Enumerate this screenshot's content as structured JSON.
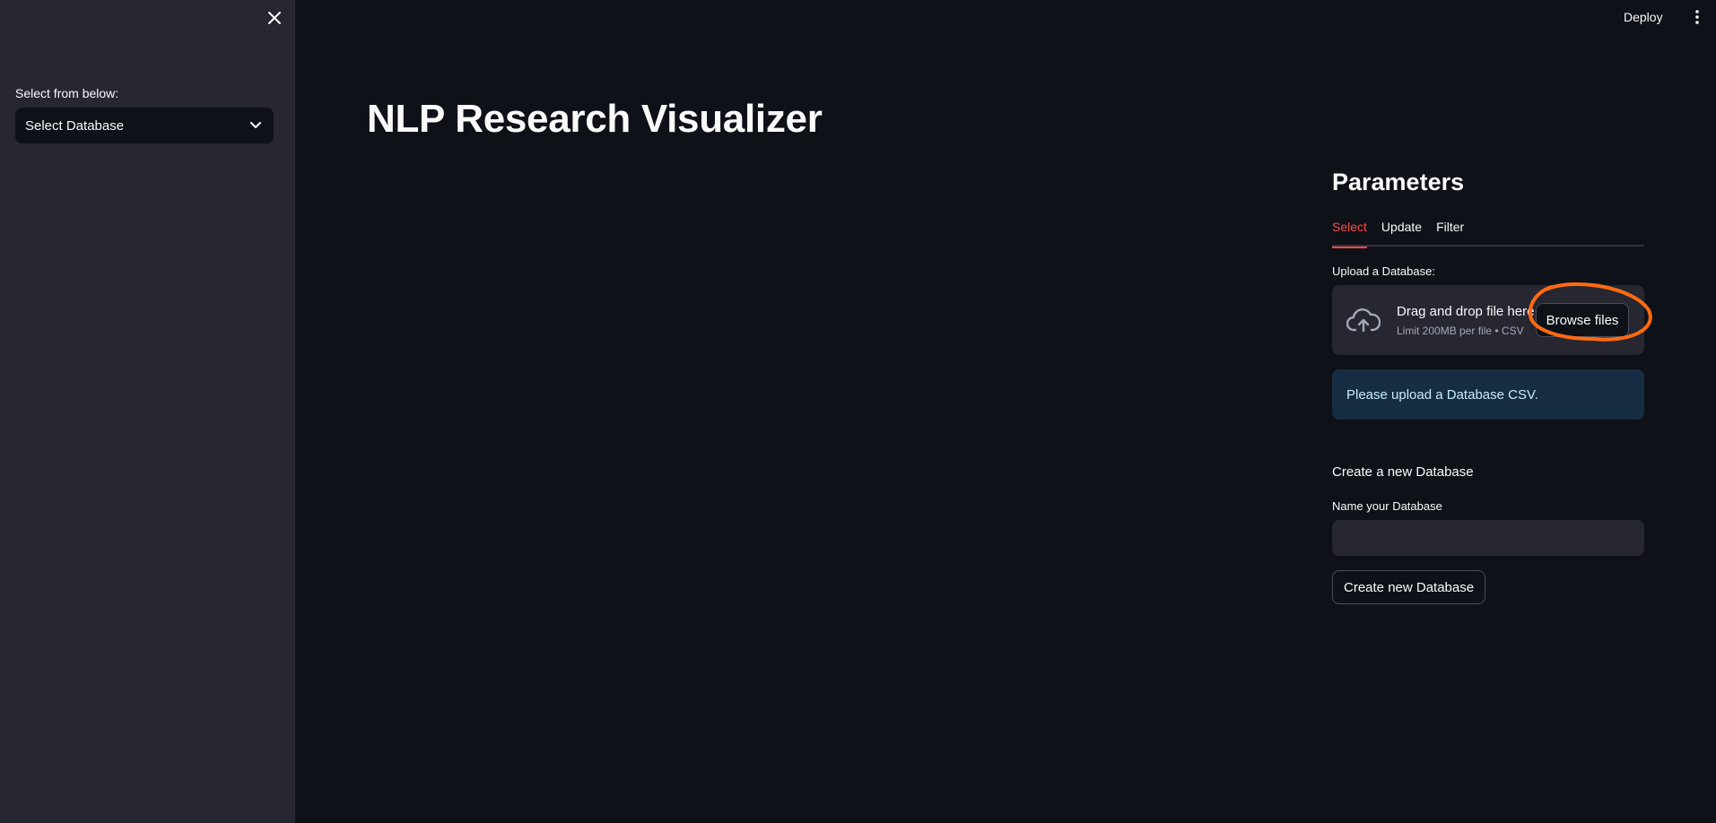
{
  "sidebar": {
    "close_icon": "close-icon",
    "label": "Select from below:",
    "select_value": "Select Database",
    "select_icon": "chevron-down-icon"
  },
  "topbar": {
    "deploy_label": "Deploy",
    "menu_icon": "vertical-ellipsis-icon"
  },
  "main": {
    "title": "NLP Research Visualizer"
  },
  "parameters": {
    "title": "Parameters",
    "tabs": [
      {
        "label": "Select",
        "active": true
      },
      {
        "label": "Update",
        "active": false
      },
      {
        "label": "Filter",
        "active": false
      }
    ],
    "upload_label": "Upload a Database:",
    "uploader": {
      "icon": "cloud-upload-icon",
      "main_text": "Drag and drop file here",
      "sub_text": "Limit 200MB per file • CSV",
      "browse_label": "Browse files"
    },
    "info_message": "Please upload a Database CSV.",
    "create_section_title": "Create a new Database",
    "name_label": "Name your Database",
    "name_value": "",
    "create_button_label": "Create new Database"
  },
  "colors": {
    "background": "#0e1117",
    "sidebar": "#262730",
    "accent": "#ff4b4b",
    "info_bg": "#172d43",
    "annotation": "#ff6a13"
  }
}
